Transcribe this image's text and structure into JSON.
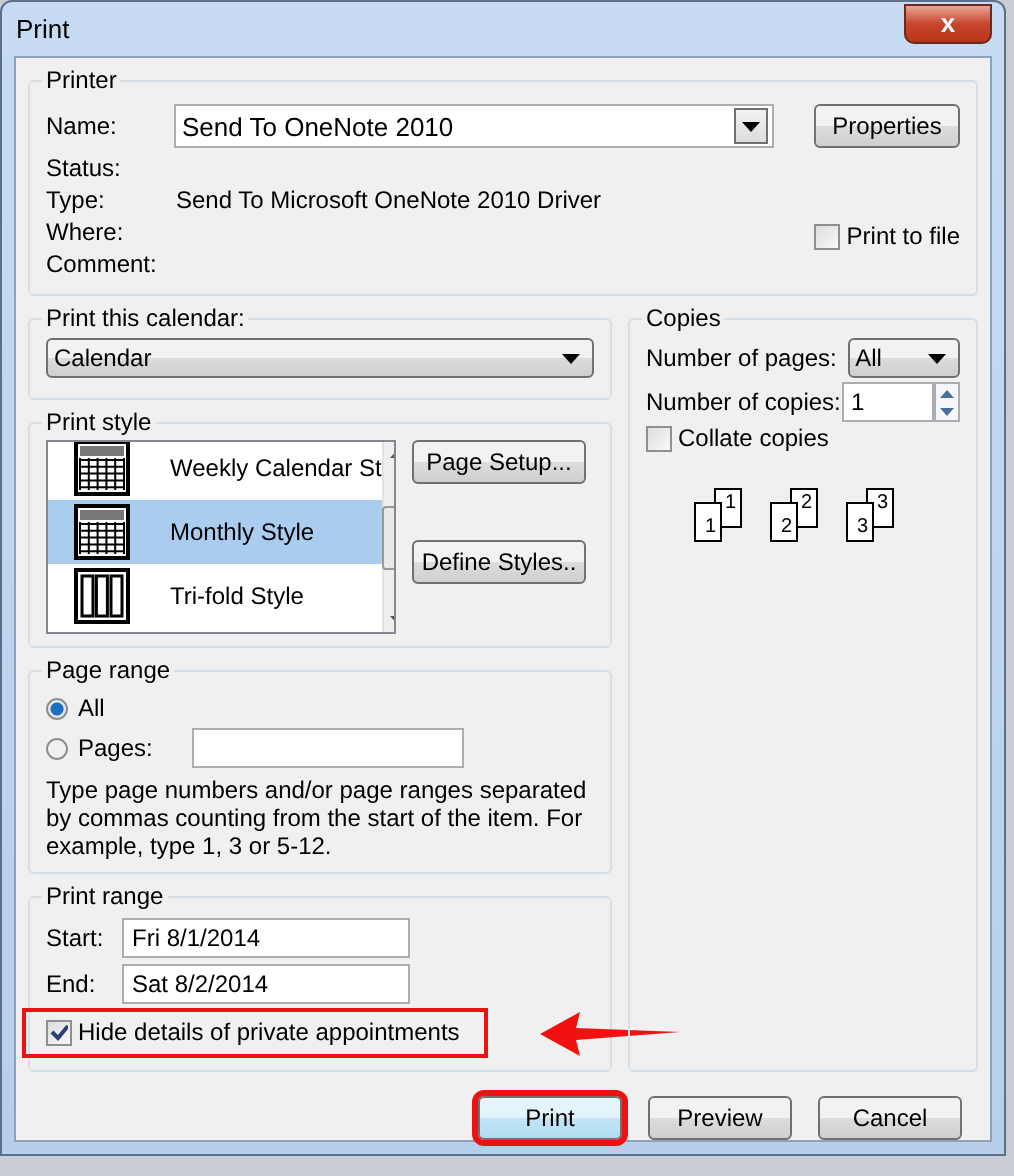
{
  "window": {
    "title": "Print",
    "close": "x"
  },
  "printer": {
    "title": "Printer",
    "name_label": "Name:",
    "name_value": "Send To OneNote 2010",
    "properties_button": "Properties",
    "info": [
      {
        "label": "Status:"
      },
      {
        "label": "Type:",
        "value": "Send To Microsoft OneNote 2010 Driver"
      },
      {
        "label": "Where:"
      },
      {
        "label": "Comment:"
      }
    ],
    "print_to_file": {
      "label": "Print to file",
      "checked": false
    }
  },
  "print_this_calendar": {
    "title": "Print this calendar:",
    "value": "Calendar"
  },
  "print_style": {
    "title": "Print style",
    "items": [
      {
        "label": "Weekly Calendar St",
        "kind": "weekly",
        "selected": false
      },
      {
        "label": "Monthly Style",
        "kind": "monthly",
        "selected": true
      },
      {
        "label": "Tri-fold Style",
        "kind": "trifold",
        "selected": false
      }
    ],
    "buttons": [
      "Page Setup...",
      "Define Styles.."
    ]
  },
  "page_range": {
    "title": "Page range",
    "options": [
      {
        "label": "All",
        "selected": true
      },
      {
        "label": "Pages:",
        "selected": false
      }
    ],
    "help": "Type page numbers and/or page ranges separated by commas counting from the start of the item.  For example, type 1, 3 or 5-12."
  },
  "print_range": {
    "title": "Print range",
    "start_label": "Start:",
    "start_value": "Fri 8/1/2014",
    "end_label": "End:",
    "end_value": "Sat 8/2/2014",
    "hide_details": {
      "label": "Hide details of private appointments",
      "checked": true,
      "highlighted": true
    }
  },
  "copies": {
    "title": "Copies",
    "pages_label": "Number of pages:",
    "pages_value": "All",
    "copies_label": "Number of copies:",
    "copies_value": "1",
    "collate": {
      "label": "Collate copies",
      "checked": false
    },
    "collate_sets": [
      {
        "back": "1",
        "front": "1"
      },
      {
        "back": "2",
        "front": "2"
      },
      {
        "back": "3",
        "front": "3"
      }
    ]
  },
  "buttons": [
    {
      "label": "Print",
      "highlighted": true
    },
    {
      "label": "Preview",
      "highlighted": false
    },
    {
      "label": "Cancel",
      "highlighted": false
    }
  ]
}
